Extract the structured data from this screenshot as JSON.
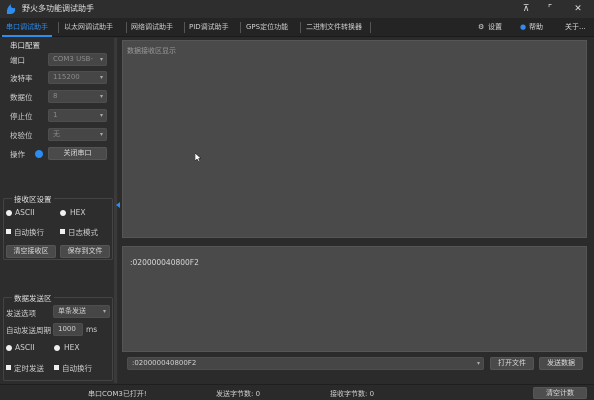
{
  "app": {
    "title": "野火多功能调试助手"
  },
  "window": {
    "pin": "⊼",
    "maximize": "⌜",
    "close": "✕"
  },
  "tabs": [
    {
      "label": "串口调试助手"
    },
    {
      "label": "以太网调试助手"
    },
    {
      "label": "网络调试助手"
    },
    {
      "label": "PID调试助手"
    },
    {
      "label": "GPS定位功能"
    },
    {
      "label": "二进制文件转换器"
    }
  ],
  "toolbar": {
    "settings": "设置",
    "help": "帮助",
    "about": "关于..."
  },
  "serial": {
    "title": "串口配置",
    "port_label": "端口",
    "port_value": "COM3 USB-",
    "baud_label": "波特率",
    "baud_value": "115200",
    "data_label": "数据位",
    "data_value": "8",
    "stop_label": "停止位",
    "stop_value": "1",
    "parity_label": "校验位",
    "parity_value": "无",
    "op_label": "操作",
    "open_btn": "关闭串口"
  },
  "receive": {
    "title": "接收区设置",
    "ascii": "ASCII",
    "hex": "HEX",
    "auto_wrap": "自动换行",
    "show_time": "日志模式",
    "clear_btn": "清空接收区",
    "save_btn": "保存到文件",
    "placeholder": "数据接收区显示"
  },
  "send": {
    "title": "数据发送区",
    "mode_label": "发送选项",
    "mode_value": "单条发送",
    "auto_label": "自动发送周期",
    "period": "1000",
    "unit": "ms",
    "ascii": "ASCII",
    "hex": "HEX",
    "opt1": "定时发送",
    "opt2": "自动换行",
    "content": ":020000040800F2",
    "input_value": ":020000040800F2",
    "open_file_btn": "打开文件",
    "send_btn": "发送数据"
  },
  "status": {
    "port_status": "串口COM3已打开!",
    "sent": "发送字节数: 0",
    "received": "接收字节数: 0",
    "clear_count_btn": "清空计数"
  },
  "colors": {
    "accent": "#2d8cf0",
    "background": "#2b2b2b",
    "panel": "#333333"
  }
}
